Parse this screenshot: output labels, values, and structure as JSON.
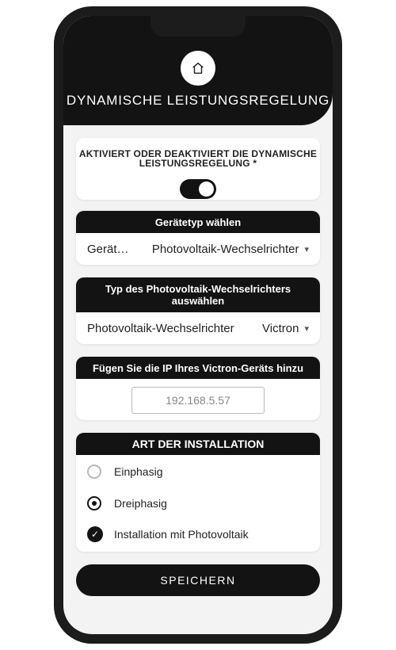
{
  "header": {
    "title": "DYNAMISCHE LEISTUNGSREGELUNG",
    "home_icon": "home-icon"
  },
  "toggle_card": {
    "text": "AKTIVIERT ODER DEAKTIVIERT DIE DYNAMISCHE LEISTUNGSREGELUNG *",
    "enabled": true
  },
  "device_type": {
    "heading": "Gerätetyp wählen",
    "label": "Gerätetyp",
    "value": "Photovoltaik-Wechselrichter",
    "arrow": "▾"
  },
  "inverter_type": {
    "heading": "Typ des Photovoltaik-Wechselrichters auswählen",
    "label": "Photovoltaik-Wechselrichter",
    "value": "Victron",
    "arrow": "▾"
  },
  "ip_card": {
    "heading": "Fügen Sie die IP Ihres Victron-Geräts hinzu",
    "placeholder": "192.168.5.57"
  },
  "installation": {
    "heading": "ART DER INSTALLATION",
    "options": [
      {
        "label": "Einphasig",
        "selected": false
      },
      {
        "label": "Dreiphasig",
        "selected": true
      }
    ],
    "checkbox": {
      "label": "Installation mit Photovoltaik",
      "checked": true,
      "mark": "✓"
    }
  },
  "save_label": "SPEICHERN"
}
